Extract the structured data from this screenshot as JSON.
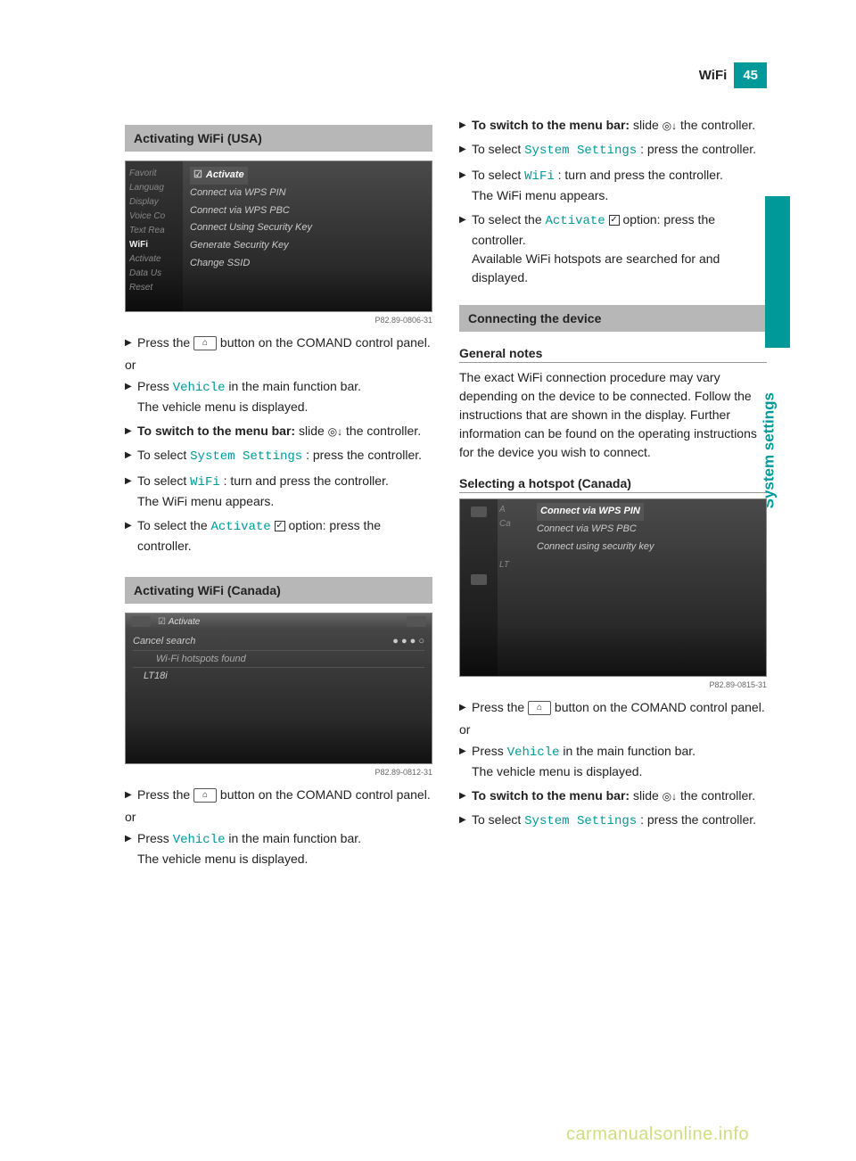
{
  "header": {
    "title": "WiFi",
    "page": "45"
  },
  "sideLabel": "System settings",
  "watermark": "carmanualsonline.info",
  "left": {
    "section1": {
      "title": "Activating WiFi (USA)",
      "ss": {
        "left": [
          "Favorit",
          "Languag",
          "Display",
          "Voice Co",
          "Text Rea",
          "WiFi",
          "Activate",
          "Data Us",
          "Reset"
        ],
        "leftHighlightIndex": 5,
        "right": [
          "Activate",
          "Connect via WPS PIN",
          "Connect via WPS PBC",
          "Connect Using Security Key",
          "Generate Security Key",
          "Change SSID"
        ],
        "caption": "P82.89-0806-31"
      },
      "steps": {
        "press_btn_pre": "Press the ",
        "press_btn_post": " button on the COMAND control panel.",
        "or": "or",
        "press_vehicle_pre": "Press ",
        "press_vehicle_code": "Vehicle",
        "press_vehicle_post": " in the main function bar.",
        "press_vehicle_result": "The vehicle menu is displayed.",
        "switch_bold": "To switch to the menu bar:",
        "switch_post": " slide ",
        "switch_end": " the controller.",
        "sys_pre": "To select ",
        "sys_code": "System Settings",
        "sys_post": ": press the controller.",
        "wifi_pre": "To select ",
        "wifi_code": "WiFi",
        "wifi_post": ": turn and press the controller.",
        "wifi_result": "The WiFi menu appears.",
        "act_pre": "To select the ",
        "act_code": "Activate",
        "act_post": " option: press the controller."
      }
    },
    "section2": {
      "title": "Activating WiFi (Canada)",
      "ss": {
        "top_left": "Activate",
        "rows": [
          "Cancel search",
          "Wi-Fi hotspots found",
          "LT18i"
        ],
        "dots": "● ● ● ○",
        "caption": "P82.89-0812-31"
      },
      "steps": {
        "press_btn_pre": "Press the ",
        "press_btn_post": " button on the COMAND control panel.",
        "or": "or",
        "press_vehicle_pre": "Press ",
        "press_vehicle_code": "Vehicle",
        "press_vehicle_post": " in the main function bar.",
        "press_vehicle_result": "The vehicle menu is displayed."
      }
    }
  },
  "right": {
    "contSteps": {
      "switch_bold": "To switch to the menu bar:",
      "switch_post": " slide ",
      "switch_end": " the controller.",
      "sys_pre": "To select ",
      "sys_code": "System Settings",
      "sys_post": ": press the controller.",
      "wifi_pre": "To select ",
      "wifi_code": "WiFi",
      "wifi_post": ": turn and press the controller.",
      "wifi_result": "The WiFi menu appears.",
      "act_pre": "To select the ",
      "act_code": "Activate",
      "act_post": " option: press the controller.",
      "act_result": "Available WiFi hotspots are searched for and displayed."
    },
    "section3": {
      "title": "Connecting the device",
      "sub1": "General notes",
      "para": "The exact WiFi connection procedure may vary depending on the device to be connected. Follow the instructions that are shown in the display. Further information can be found on the operating instructions for the device you wish to connect.",
      "sub2": "Selecting a hotspot (Canada)",
      "ss": {
        "mid": [
          "A",
          "Ca",
          "LT"
        ],
        "right": [
          "Connect via WPS PIN",
          "Connect via WPS PBC",
          "Connect using security key"
        ],
        "caption": "P82.89-0815-31"
      },
      "steps": {
        "press_btn_pre": "Press the ",
        "press_btn_post": " button on the COMAND control panel.",
        "or": "or",
        "press_vehicle_pre": "Press ",
        "press_vehicle_code": "Vehicle",
        "press_vehicle_post": " in the main function bar.",
        "press_vehicle_result": "The vehicle menu is displayed.",
        "switch_bold": "To switch to the menu bar:",
        "switch_post": " slide ",
        "switch_end": " the controller.",
        "sys_pre": "To select ",
        "sys_code": "System Settings",
        "sys_post": ": press the controller."
      }
    }
  },
  "icons": {
    "comand_button": "⌂",
    "slider": "◎↓",
    "check": "✓"
  }
}
